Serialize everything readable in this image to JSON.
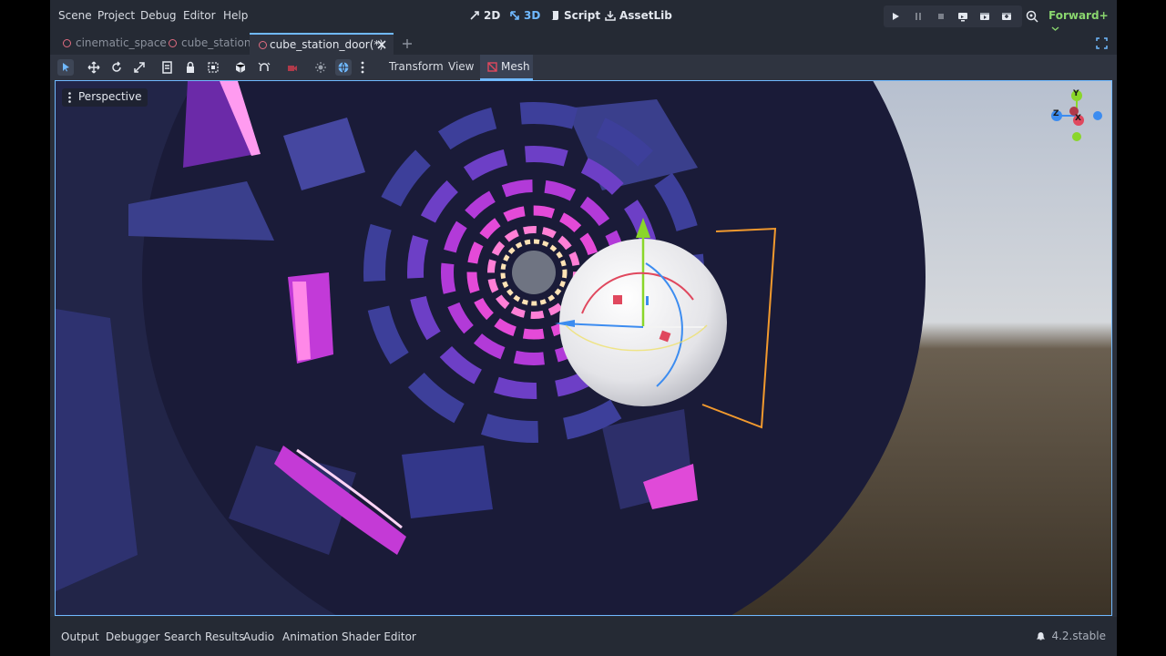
{
  "menubar": {
    "items": [
      "Scene",
      "Project",
      "Debug",
      "Editor",
      "Help"
    ]
  },
  "workspaces": {
    "items": [
      "2D",
      "3D",
      "Script",
      "AssetLib"
    ],
    "active": "3D"
  },
  "renderer": {
    "label": "Forward+"
  },
  "tabs": {
    "items": [
      "cinematic_space",
      "cube_station",
      "cube_station_door(*)"
    ],
    "active": 2
  },
  "toolbar": {
    "menus": [
      "Transform",
      "View",
      "Mesh"
    ]
  },
  "viewport": {
    "view_label": "Perspective",
    "gizmo_axes": [
      "Y",
      "Z",
      "X"
    ]
  },
  "bottom_panel": {
    "tabs": [
      "Output",
      "Debugger",
      "Search Results",
      "Audio",
      "Animation",
      "Shader Editor"
    ],
    "version": "4.2.stable"
  },
  "colors": {
    "accent": "#70b9ff",
    "renderer": "#8ad66e",
    "axis_x": "#e0485e",
    "axis_y": "#8ad62a",
    "axis_z": "#3c8cf0"
  }
}
